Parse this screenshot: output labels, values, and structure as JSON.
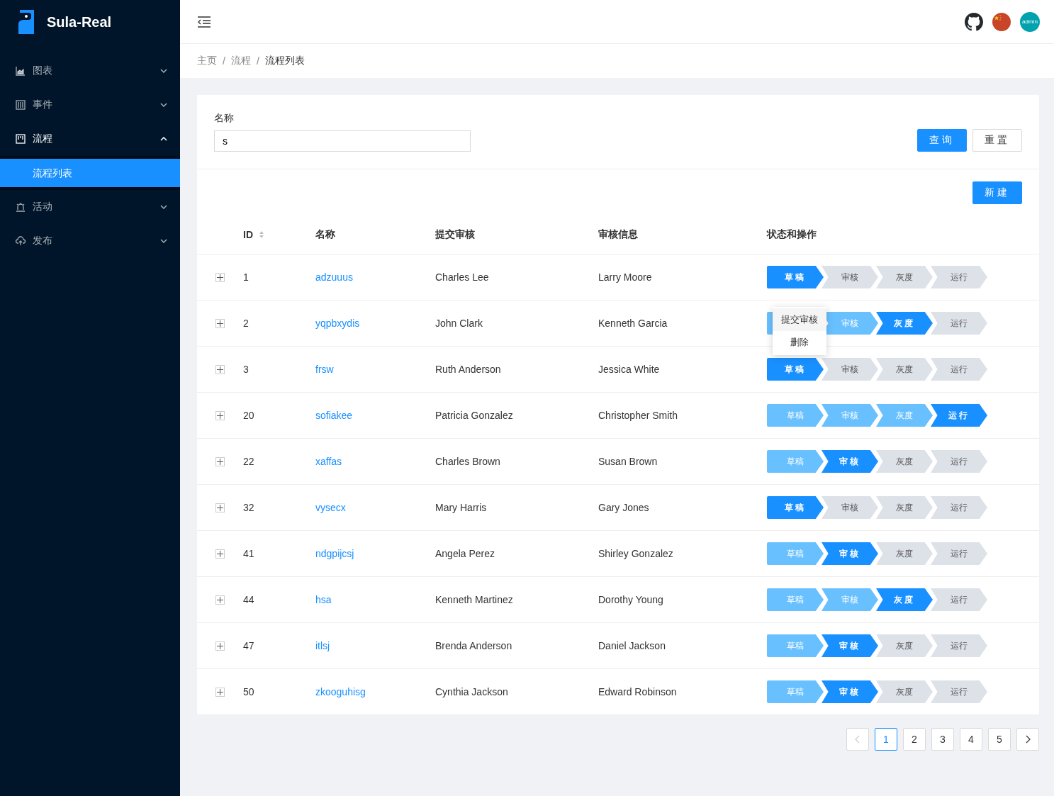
{
  "app": {
    "title": "Sula-Real"
  },
  "sidebar": {
    "items": [
      {
        "label": "图表",
        "expanded": false
      },
      {
        "label": "事件",
        "expanded": false
      },
      {
        "label": "流程",
        "expanded": true,
        "children": [
          {
            "label": "流程列表",
            "selected": true
          }
        ]
      },
      {
        "label": "活动",
        "expanded": false
      },
      {
        "label": "发布",
        "expanded": false
      }
    ]
  },
  "header": {
    "avatar": "admin"
  },
  "breadcrumb": [
    {
      "kind": "link",
      "text": "主页"
    },
    {
      "kind": "separator",
      "text": "/"
    },
    {
      "kind": "link",
      "text": "流程"
    },
    {
      "kind": "separator",
      "text": "/"
    },
    {
      "kind": "current",
      "text": "流程列表"
    }
  ],
  "form": {
    "label": "名称",
    "value": "s",
    "buttons": [
      {
        "label": "查询",
        "primary": true
      },
      {
        "label": "重置",
        "primary": false
      }
    ]
  },
  "new_button": "新建",
  "table": {
    "columns": [
      {
        "label": "ID",
        "sortable": true
      },
      {
        "label": "名称",
        "sortable": false
      },
      {
        "label": "提交审核",
        "sortable": false
      },
      {
        "label": "审核信息",
        "sortable": false
      },
      {
        "label": "状态和操作",
        "sortable": false
      }
    ],
    "rows": [
      {
        "id": "1",
        "name": "adzuuus",
        "submitter": "Charles Lee",
        "reviewer": "Larry Moore",
        "steps": [
          {
            "label": "草稿",
            "done": false,
            "current": true
          },
          {
            "label": "审核",
            "done": false,
            "current": false
          },
          {
            "label": "灰度",
            "done": false,
            "current": false
          },
          {
            "label": "运行",
            "done": false,
            "current": false
          }
        ]
      },
      {
        "id": "2",
        "name": "yqpbxydis",
        "submitter": "John Clark",
        "reviewer": "Kenneth Garcia",
        "steps": [
          {
            "done": true,
            "current": false
          },
          {
            "label": "审核",
            "done": true,
            "current": false
          },
          {
            "label": "灰度",
            "done": false,
            "current": true
          },
          {
            "label": "运行",
            "done": false,
            "current": false
          }
        ],
        "menu": [
          "提交审核",
          "删除"
        ]
      },
      {
        "id": "3",
        "name": "frsw",
        "submitter": "Ruth Anderson",
        "reviewer": "Jessica White",
        "steps": [
          {
            "label": "草稿",
            "done": false,
            "current": true
          },
          {
            "label": "审核",
            "done": false,
            "current": false
          },
          {
            "label": "灰度",
            "done": false,
            "current": false
          },
          {
            "label": "运行",
            "done": false,
            "current": false
          }
        ]
      },
      {
        "id": "20",
        "name": "sofiakee",
        "submitter": "Patricia Gonzalez",
        "reviewer": "Christopher Smith",
        "steps": [
          {
            "label": "草稿",
            "done": true,
            "current": false
          },
          {
            "label": "审核",
            "done": true,
            "current": false
          },
          {
            "label": "灰度",
            "done": true,
            "current": false
          },
          {
            "label": "运行",
            "done": false,
            "current": true
          }
        ]
      },
      {
        "id": "22",
        "name": "xaffas",
        "submitter": "Charles Brown",
        "reviewer": "Susan Brown",
        "steps": [
          {
            "label": "草稿",
            "done": true,
            "current": false
          },
          {
            "label": "审核",
            "done": false,
            "current": true
          },
          {
            "label": "灰度",
            "done": false,
            "current": false
          },
          {
            "label": "运行",
            "done": false,
            "current": false
          }
        ]
      },
      {
        "id": "32",
        "name": "vysecx",
        "submitter": "Mary Harris",
        "reviewer": "Gary Jones",
        "steps": [
          {
            "label": "草稿",
            "done": false,
            "current": true
          },
          {
            "label": "审核",
            "done": false,
            "current": false
          },
          {
            "label": "灰度",
            "done": false,
            "current": false
          },
          {
            "label": "运行",
            "done": false,
            "current": false
          }
        ]
      },
      {
        "id": "41",
        "name": "ndgpijcsj",
        "submitter": "Angela Perez",
        "reviewer": "Shirley Gonzalez",
        "steps": [
          {
            "label": "草稿",
            "done": true,
            "current": false
          },
          {
            "label": "审核",
            "done": false,
            "current": true
          },
          {
            "label": "灰度",
            "done": false,
            "current": false
          },
          {
            "label": "运行",
            "done": false,
            "current": false
          }
        ]
      },
      {
        "id": "44",
        "name": "hsa",
        "submitter": "Kenneth Martinez",
        "reviewer": "Dorothy Young",
        "steps": [
          {
            "label": "草稿",
            "done": true,
            "current": false
          },
          {
            "label": "审核",
            "done": true,
            "current": false
          },
          {
            "label": "灰度",
            "done": false,
            "current": true
          },
          {
            "label": "运行",
            "done": false,
            "current": false
          }
        ]
      },
      {
        "id": "47",
        "name": "itlsj",
        "submitter": "Brenda Anderson",
        "reviewer": "Daniel Jackson",
        "steps": [
          {
            "label": "草稿",
            "done": true,
            "current": false
          },
          {
            "label": "审核",
            "done": false,
            "current": true
          },
          {
            "label": "灰度",
            "done": false,
            "current": false
          },
          {
            "label": "运行",
            "done": false,
            "current": false
          }
        ]
      },
      {
        "id": "50",
        "name": "zkooguhisg",
        "submitter": "Cynthia Jackson",
        "reviewer": "Edward Robinson",
        "steps": [
          {
            "label": "草稿",
            "done": true,
            "current": false
          },
          {
            "label": "审核",
            "done": false,
            "current": true
          },
          {
            "label": "灰度",
            "done": false,
            "current": false
          },
          {
            "label": "运行",
            "done": false,
            "current": false
          }
        ]
      }
    ]
  },
  "pagination": {
    "prev": {
      "disabled": true
    },
    "pages": [
      {
        "label": "1",
        "selected": true
      },
      {
        "label": "2",
        "selected": false
      },
      {
        "label": "3",
        "selected": false
      },
      {
        "label": "4",
        "selected": false
      },
      {
        "label": "5",
        "selected": false
      }
    ],
    "next": {
      "disabled": false
    }
  }
}
